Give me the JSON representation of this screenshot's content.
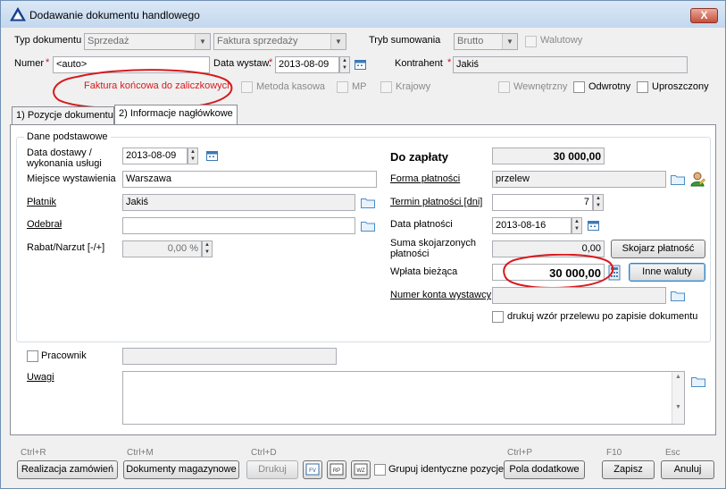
{
  "window": {
    "title": "Dodawanie dokumentu handlowego",
    "close_label": "X"
  },
  "header": {
    "typ_label": "Typ dokumentu",
    "typ_value": "Sprzedaż",
    "typ2_value": "Faktura sprzedaży",
    "tryb_label": "Tryb sumowania",
    "tryb_value": "Brutto",
    "walutowy_label": "Walutowy",
    "numer_label": "Numer",
    "numer_value": "<auto>",
    "data_wystaw_label": "Data wystaw.",
    "data_wystaw_value": "2013-08-09",
    "kontrahent_label": "Kontrahent",
    "kontrahent_value": "Jakiś",
    "annotation": "Faktura końcowa do zaliczkowych",
    "metoda_kasowa_label": "Metoda kasowa",
    "mp_label": "MP",
    "krajowy_label": "Krajowy",
    "wewnetrzny_label": "Wewnętrzny",
    "odwrotny_label": "Odwrotny",
    "uproszczony_label": "Uproszczony",
    "required_mark": "*"
  },
  "tabs": [
    {
      "label": "1) Pozycje dokumentu"
    },
    {
      "label": "2) Informacje nagłówkowe"
    }
  ],
  "left": {
    "group_title": "Dane podstawowe",
    "data_dostawy_label_1": "Data dostawy /",
    "data_dostawy_label_2": "wykonania usługi",
    "data_dostawy_value": "2013-08-09",
    "miejsce_label": "Miejsce wystawienia",
    "miejsce_value": "Warszawa",
    "platnik_label": "Płatnik",
    "platnik_value": "Jakiś",
    "odebral_label": "Odebrał",
    "odebral_value": "",
    "rabat_label": "Rabat/Narzut [-/+]",
    "rabat_value": "0,00 %",
    "pracownik_label": "Pracownik",
    "uwagi_label": "Uwagi"
  },
  "right": {
    "do_zaplaty_label": "Do zapłaty",
    "do_zaplaty_value": "30 000,00",
    "forma_label": "Forma płatności",
    "forma_value": "przelew",
    "termin_label": "Termin płatności [dni]",
    "termin_value": "7",
    "data_platnosci_label": "Data płatności",
    "data_platnosci_value": "2013-08-16",
    "suma_label_1": "Suma skojarzonych",
    "suma_label_2": "płatności",
    "suma_value": "0,00",
    "skojarz_button": "Skojarz płatność",
    "wplata_label": "Wpłata bieżąca",
    "wplata_value": "30 000,00",
    "inne_waluty_button": "Inne waluty",
    "numer_konta_label": "Numer konta wystawcy",
    "numer_konta_value": "",
    "drukuj_label": "drukuj wzór przelewu po zapisie dokumentu"
  },
  "footer": {
    "hotkey_realizacja": "Ctrl+R",
    "realizacja_button": "Realizacja zamówień",
    "hotkey_dokumenty": "Ctrl+M",
    "dokumenty_button": "Dokumenty magazynowe",
    "hotkey_drukuj": "Ctrl+D",
    "drukuj_button": "Drukuj",
    "icon1_label": "FV",
    "icon2_label": "RP",
    "icon3_label": "WZ",
    "grupuj_label": "Grupuj identyczne pozycje",
    "hotkey_pola": "Ctrl+P",
    "pola_button": "Pola dodatkowe",
    "hotkey_zapisz": "F10",
    "zapisz_button": "Zapisz",
    "hotkey_anuluj": "Esc",
    "anuluj_button": "Anuluj"
  },
  "colors": {
    "annotation_red": "#d8191c",
    "accent_blue": "#2a6fb8",
    "required_red": "#c8102e"
  }
}
